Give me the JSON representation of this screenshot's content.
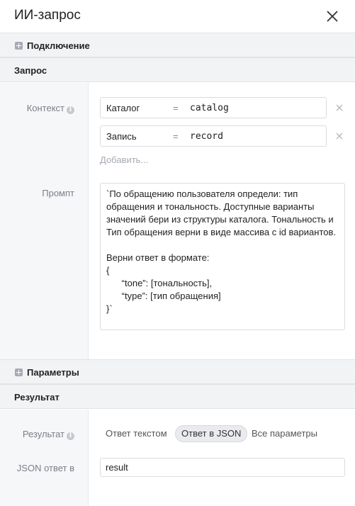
{
  "dialog": {
    "title": "ИИ-запрос"
  },
  "sections": {
    "connection": "Подключение",
    "request": "Запрос",
    "parameters": "Параметры",
    "result": "Результат"
  },
  "request": {
    "context_label": "Контекст",
    "context_items": [
      {
        "key": "Каталог",
        "eq": "=",
        "value": "catalog"
      },
      {
        "key": "Запись",
        "eq": "=",
        "value": "record"
      }
    ],
    "add_label": "Добавить...",
    "prompt_label": "Промпт",
    "prompt_text": "`По обращению пользователя определи: тип обращения и тональность. Доступные варианты значений бери из структуры каталога. Тональность и Тип обращения верни в виде массива с id вариантов.\n\nВерни ответ в формате:\n{\n      “tone”: [тональность],\n      “type”: [тип обращения]\n}`"
  },
  "result": {
    "result_label": "Результат",
    "options": [
      "Ответ текстом",
      "Ответ в JSON",
      "Все параметры"
    ],
    "selected": "Ответ в JSON",
    "json_label": "JSON ответ в",
    "json_value": "result"
  },
  "icons": {
    "close": "close-icon",
    "expand": "plus-square-icon",
    "info": "info-icon",
    "remove": "remove-x-icon"
  }
}
